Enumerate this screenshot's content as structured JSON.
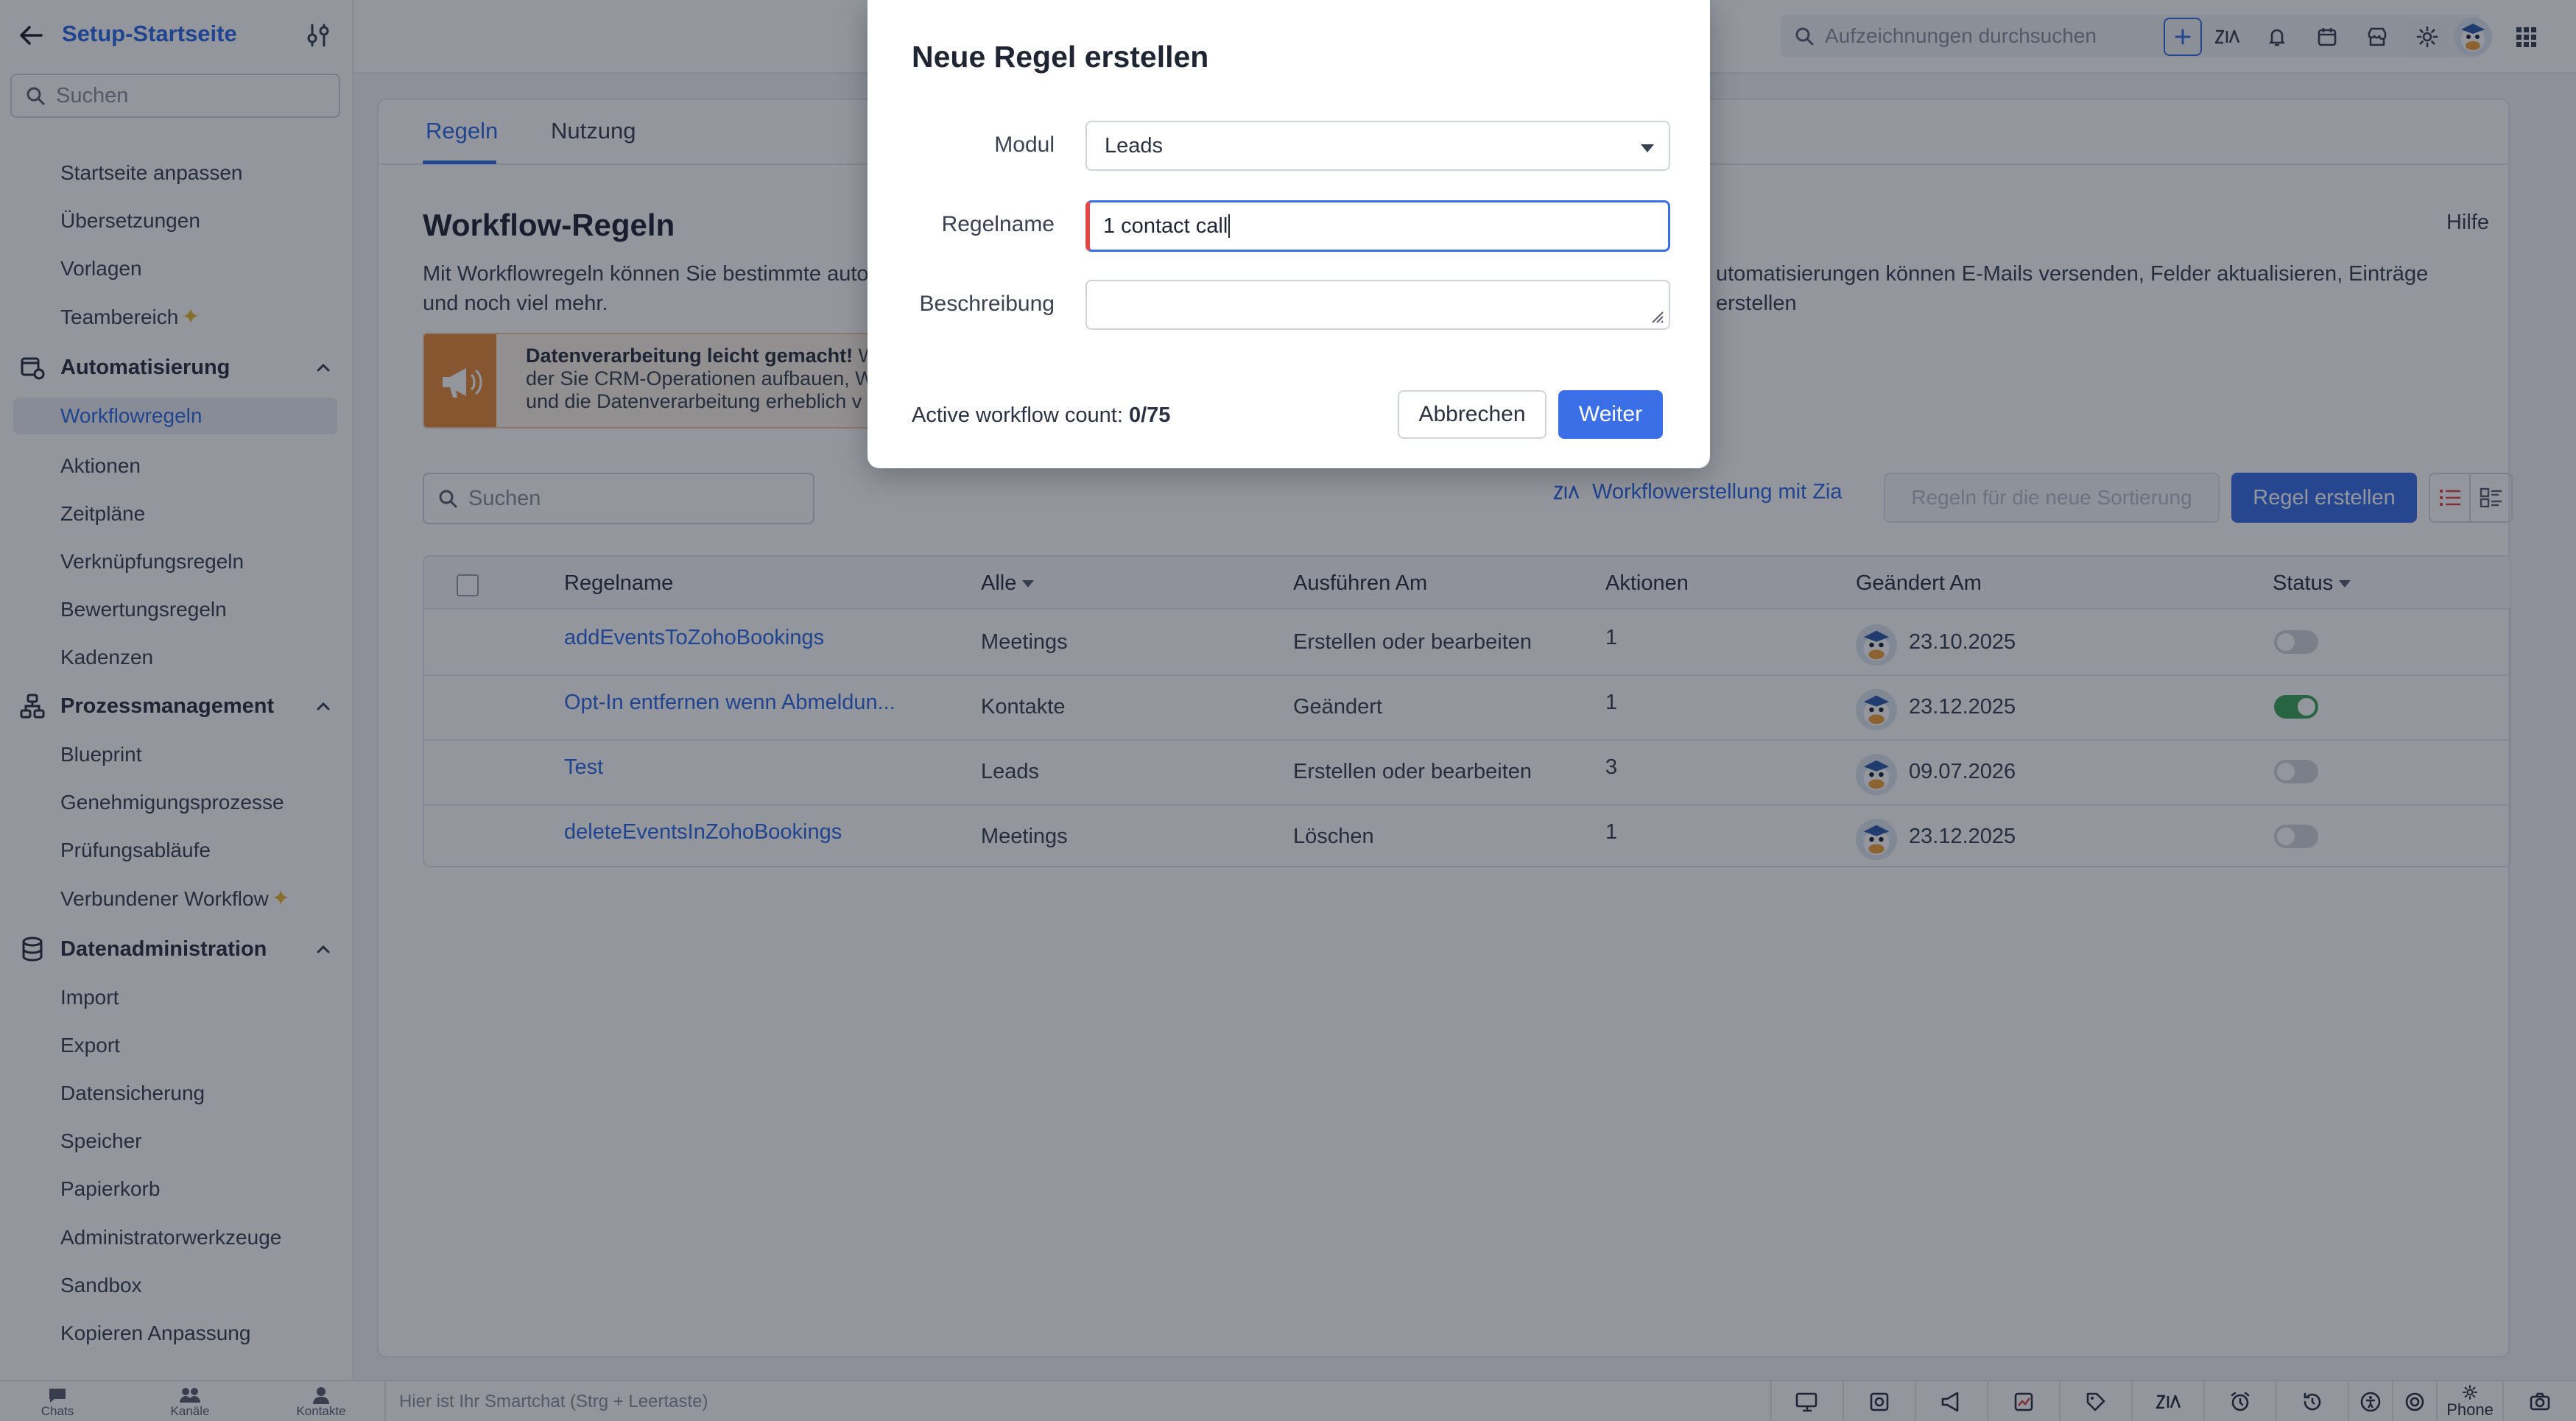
{
  "sidebar": {
    "back_icon": "arrow-left-icon",
    "title": "Setup-Startseite",
    "search_placeholder": "Suchen",
    "items_top": [
      "Startseite anpassen",
      "Übersetzungen",
      "Vorlagen",
      "Teambereich"
    ],
    "groups": [
      {
        "label": "Automatisierung",
        "items": [
          "Workflowregeln",
          "Aktionen",
          "Zeitpläne",
          "Verknüpfungsregeln",
          "Bewertungsregeln",
          "Kadenzen"
        ]
      },
      {
        "label": "Prozessmanagement",
        "items": [
          "Blueprint",
          "Genehmigungsprozesse",
          "Prüfungsabläufe",
          "Verbundener Workflow"
        ]
      },
      {
        "label": "Datenadministration",
        "items": [
          "Import",
          "Export",
          "Datensicherung",
          "Speicher",
          "Papierkorb",
          "Administratorwerkzeuge",
          "Sandbox",
          "Kopieren Anpassung"
        ]
      }
    ],
    "active_item": "Workflowregeln"
  },
  "topbar": {
    "search_placeholder": "Aufzeichnungen durchsuchen"
  },
  "main": {
    "tabs": [
      "Regeln",
      "Nutzung"
    ],
    "title": "Workflow-Regeln",
    "help": "Hilfe",
    "description_left": "Mit Workflowregeln können Sie bestimmte auto",
    "description_right": "utomatisierungen können E-Mails versenden, Felder aktualisieren, Einträge erstellen",
    "description_line2": "und noch viel mehr.",
    "banner_bold": "Datenverarbeitung leicht gemacht!",
    "banner_line1": " W",
    "banner_line2": "der Sie CRM-Operationen aufbauen, W",
    "banner_line3": "und die Datenverarbeitung erheblich v",
    "search_placeholder": "Suchen",
    "zia_link": "Workflowerstellung mit Zia",
    "sort_button": "Regeln für die neue Sortierung",
    "create_button": "Regel erstellen"
  },
  "table": {
    "headers": {
      "name": "Regelname",
      "module": "Alle",
      "execute": "Ausführen Am",
      "actions": "Aktionen",
      "modified": "Geändert Am",
      "status": "Status"
    },
    "rows": [
      {
        "name": "addEventsToZohoBookings",
        "module": "Meetings",
        "execute": "Erstellen oder bearbeiten",
        "actions": "1",
        "modified": "23.10.2025",
        "active": false
      },
      {
        "name": "Opt-In entfernen wenn Abmeldun...",
        "module": "Kontakte",
        "execute": "Geändert",
        "actions": "1",
        "modified": "23.12.2025",
        "active": true
      },
      {
        "name": "Test",
        "module": "Leads",
        "execute": "Erstellen oder bearbeiten",
        "actions": "3",
        "modified": "09.07.2026",
        "active": false
      },
      {
        "name": "deleteEventsInZohoBookings",
        "module": "Meetings",
        "execute": "Löschen",
        "actions": "1",
        "modified": "23.12.2025",
        "active": false
      }
    ]
  },
  "bottombar": {
    "chats": "Chats",
    "channels": "Kanäle",
    "contacts": "Kontakte",
    "smartchat_placeholder": "Hier ist Ihr Smartchat (Strg + Leertaste)",
    "phone": "Phone"
  },
  "modal": {
    "title": "Neue Regel erstellen",
    "module_label": "Modul",
    "module_value": "Leads",
    "rulename_label": "Regelname",
    "rulename_value": "1 contact call",
    "description_label": "Beschreibung",
    "count_label": "Active workflow count: ",
    "count_value": "0/75",
    "cancel": "Abbrechen",
    "next": "Weiter"
  },
  "colors": {
    "accent": "#3a6fe8",
    "link": "#2e6be6",
    "toggle_on": "#3fa45a",
    "banner": "#e58b3a"
  }
}
